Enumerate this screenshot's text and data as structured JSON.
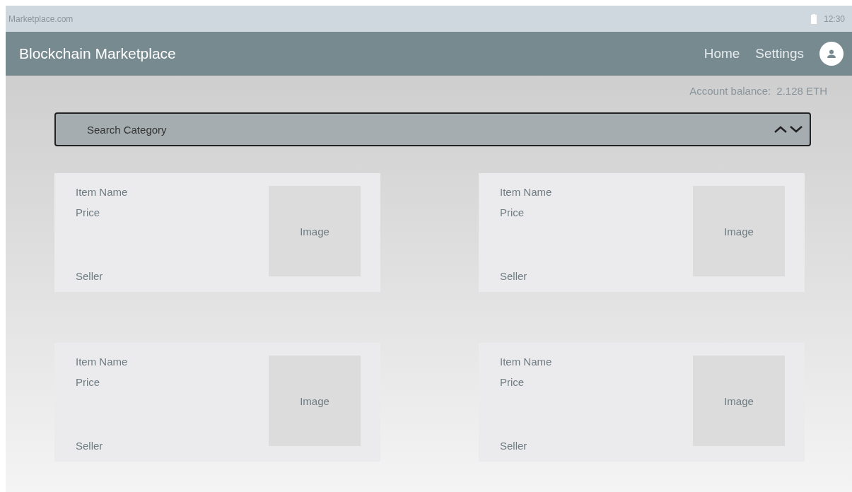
{
  "status_bar": {
    "url": "Marketplace.com",
    "time": "12:30"
  },
  "header": {
    "title": "Blockchain Marketplace",
    "nav": [
      "Home",
      "Settings"
    ]
  },
  "account_balance": {
    "label": "Account balance:",
    "value": "2.128 ETH"
  },
  "search": {
    "placeholder": "Search Category"
  },
  "items": [
    {
      "name": "Item Name",
      "price": "Price",
      "seller": "Seller",
      "image": "Image"
    },
    {
      "name": "Item Name",
      "price": "Price",
      "seller": "Seller",
      "image": "Image"
    },
    {
      "name": "Item Name",
      "price": "Price",
      "seller": "Seller",
      "image": "Image"
    },
    {
      "name": "Item Name",
      "price": "Price",
      "seller": "Seller",
      "image": "Image"
    }
  ]
}
